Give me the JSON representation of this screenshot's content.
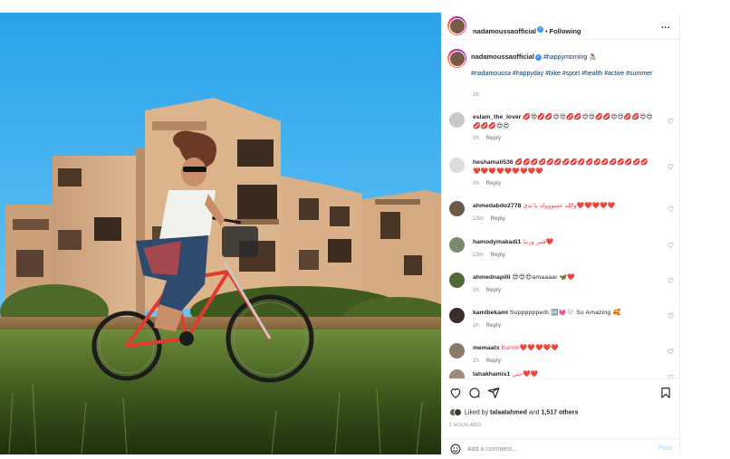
{
  "header": {
    "username": "nadamoussaofficial",
    "separator": "•",
    "follow_status": "Following",
    "more_label": "..."
  },
  "caption": {
    "username": "nadamoussaofficial",
    "first_tag": "#happymorning",
    "first_emoji": "🚴‍♀️",
    "tags": "#nadamoussa #happyday #bike #sport #health #active #summer",
    "time": "1h"
  },
  "comments": [
    {
      "username": "eslam_the_lover",
      "text": "💋😍💋💋😍😍💋💋😍😍💋💋😍😍💋💋😍😍💋💋💋😍😍",
      "time": "1h",
      "reply": "Reply"
    },
    {
      "username": "heshamali536",
      "text": "💋💋💋💋💋💋💋💋💋💋💋💋💋💋💋💋💋❤️❤️❤️❤️❤️❤️❤️❤️❤️",
      "time": "1h",
      "reply": "Reply"
    },
    {
      "username": "ahmedabdo2778",
      "text": "والله عسوووله يا ندي❤️❤️❤️❤️❤️",
      "time": "13m",
      "reply": "Reply"
    },
    {
      "username": "hamodymakadi1",
      "text": "قمر وربنا❤️",
      "time": "13m",
      "reply": "Reply"
    },
    {
      "username": "ahmednapilll",
      "text": "😍😍😍amaaaar 🦋❤️",
      "time": "1h",
      "reply": "Reply"
    },
    {
      "username": "kamlbekaml",
      "text": "Supppppperb 🆒💓🤍 So Amazing 🥰",
      "time": "1h",
      "reply": "Reply"
    },
    {
      "username": "memaatx",
      "text": "Bahbk❤️❤️❤️❤️❤️",
      "time": "1h",
      "reply": "Reply"
    },
    {
      "username": "tahakhamis1",
      "text": "حبي❤️❤️",
      "time": "",
      "reply": ""
    }
  ],
  "likes": {
    "prefix": "Liked by",
    "user": "talaatahmed",
    "conjunction": "and",
    "others": "1,517 others"
  },
  "time_ago": "1 HOUR AGO",
  "add_comment": {
    "placeholder": "Add a comment...",
    "post_label": "Post"
  },
  "colors": {
    "link": "#00376b",
    "verified": "#3897f0",
    "heart_red": "#ed4956",
    "post_disabled": "#b2dffc"
  },
  "icons": [
    "more-icon",
    "verified-icon",
    "like-icon",
    "comment-icon",
    "share-icon",
    "save-icon",
    "emoji-icon",
    "heart-icon"
  ]
}
